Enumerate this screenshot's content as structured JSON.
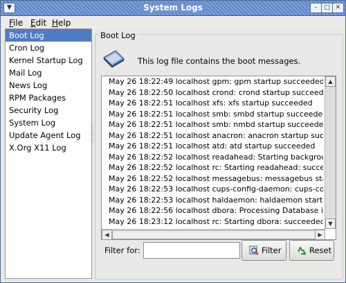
{
  "window": {
    "title": "System Logs"
  },
  "menubar": {
    "items": [
      "File",
      "Edit",
      "Help"
    ],
    "mnemonics": [
      "F",
      "E",
      "H"
    ],
    "rest": [
      "ile",
      "dit",
      "elp"
    ]
  },
  "sidebar": {
    "items": [
      "Boot Log",
      "Cron Log",
      "Kernel Startup Log",
      "Mail Log",
      "News Log",
      "RPM Packages",
      "Security Log",
      "System Log",
      "Update Agent Log",
      "X.Org X11 Log"
    ],
    "selected": "Boot Log"
  },
  "main": {
    "frame_label": "Boot Log",
    "description": "This log file contains the boot messages.",
    "log_lines": [
      "May 26 18:22:49 localhost gpm: gpm startup succeeded",
      "May 26 18:22:50 localhost crond: crond startup succeeded",
      "May 26 18:22:51 localhost xfs: xfs startup succeeded",
      "May 26 18:22:51 localhost smb: smbd startup succeeded",
      "May 26 18:22:51 localhost smb: nmbd startup succeeded",
      "May 26 18:22:51 localhost anacron: anacron startup succeeded",
      "May 26 18:22:51 localhost atd: atd startup succeeded",
      "May 26 18:22:52 localhost readahead: Starting background readahead",
      "May 26 18:22:52 localhost rc: Starting readahead:  succeeded",
      "May 26 18:22:52 localhost messagebus: messagebus startup succeeded",
      "May 26 18:22:53 localhost cups-config-daemon: cups-config-daemon",
      "May 26 18:22:53 localhost haldaemon: haldaemon startup succeeded",
      "May 26 18:22:56 localhost dbora: Processing Database instance \"or",
      "May 26 18:23:12 localhost rc: Starting dbora:  succeeded"
    ]
  },
  "filter": {
    "label": "Filter for:",
    "value": "",
    "filter_button": "Filter",
    "reset_button": "Reset"
  },
  "icons": {
    "window_menu": "chevron-down-icon",
    "minimize": "minimize-icon",
    "maximize": "maximize-icon",
    "close": "close-icon",
    "log": "book-icon",
    "filter": "magnifier-icon",
    "reset": "recycle-icon"
  },
  "colors": {
    "titlebar": "#6e92d2",
    "selection": "#4f7cc4"
  }
}
